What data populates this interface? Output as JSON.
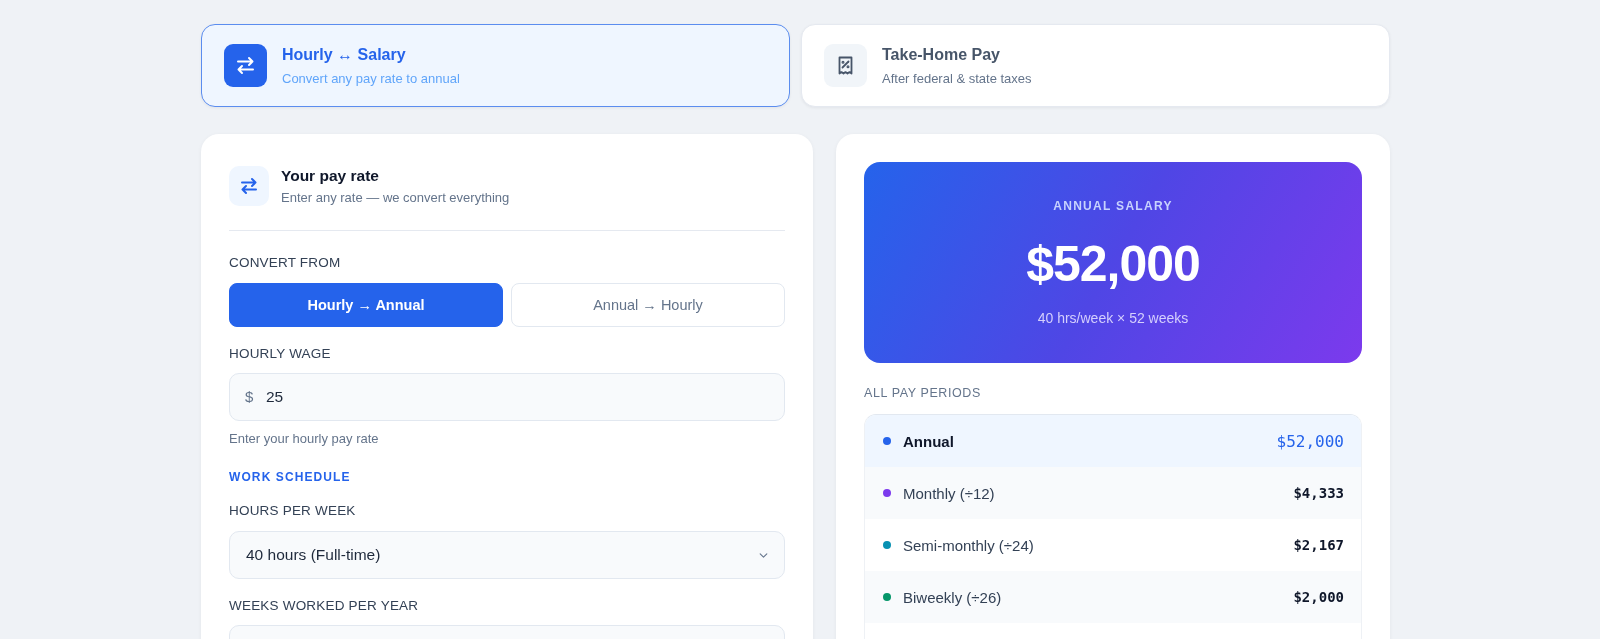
{
  "mode_tabs": [
    {
      "title": "Hourly ↔ Salary",
      "subtitle": "Convert any pay rate to annual",
      "selected": true
    },
    {
      "title": "Take-Home Pay",
      "subtitle": "After federal & state taxes",
      "selected": false
    }
  ],
  "input_card": {
    "title": "Your pay rate",
    "subtitle": "Enter any rate — we convert everything",
    "convert_from": {
      "label": "CONVERT FROM",
      "options": [
        {
          "label": "Hourly → Annual",
          "selected": true
        },
        {
          "label": "Annual → Hourly",
          "selected": false
        }
      ]
    },
    "hourly_wage": {
      "label": "HOURLY WAGE",
      "prefix": "$",
      "value": "25",
      "hint": "Enter your hourly pay rate"
    },
    "section_title": "WORK SCHEDULE",
    "hours_per_week": {
      "label": "HOURS PER WEEK",
      "value": "40 hours (Full-time)"
    },
    "weeks_per_year": {
      "label": "WEEKS WORKED PER YEAR"
    }
  },
  "result_card": {
    "hero": {
      "label": "ANNUAL SALARY",
      "amount": "$52,000",
      "detail": "40 hrs/week × 52 weeks"
    },
    "periods_title": "ALL PAY PERIODS",
    "periods": [
      {
        "label": "Annual",
        "value": "$52,000",
        "color": "#2563eb",
        "selected": true
      },
      {
        "label": "Monthly (÷12)",
        "value": "$4,333",
        "color": "#7c3aed",
        "selected": false
      },
      {
        "label": "Semi-monthly (÷24)",
        "value": "$2,167",
        "color": "#0891b2",
        "selected": false
      },
      {
        "label": "Biweekly (÷26)",
        "value": "$2,000",
        "color": "#059669",
        "selected": false
      }
    ]
  }
}
